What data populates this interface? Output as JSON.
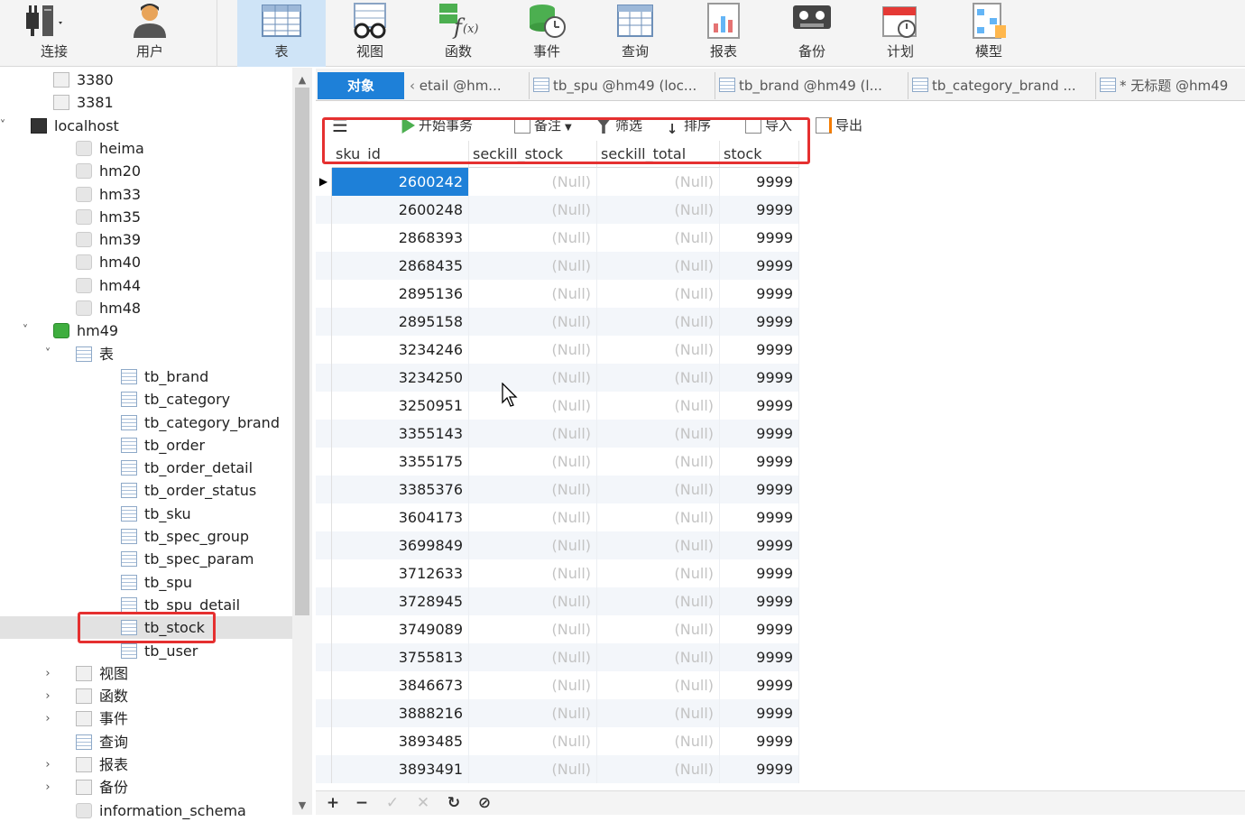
{
  "toolbar": {
    "connect": "连接",
    "user": "用户",
    "table": "表",
    "view": "视图",
    "function": "函数",
    "event": "事件",
    "query": "查询",
    "report": "报表",
    "backup": "备份",
    "schedule": "计划",
    "model": "模型"
  },
  "sidebar": {
    "items": [
      {
        "label": "3380"
      },
      {
        "label": "3381"
      },
      {
        "label": "localhost"
      },
      {
        "label": "heima"
      },
      {
        "label": "hm20"
      },
      {
        "label": "hm33"
      },
      {
        "label": "hm35"
      },
      {
        "label": "hm39"
      },
      {
        "label": "hm40"
      },
      {
        "label": "hm44"
      },
      {
        "label": "hm48"
      },
      {
        "label": "hm49"
      },
      {
        "label": "表"
      },
      {
        "label": "tb_brand"
      },
      {
        "label": "tb_category"
      },
      {
        "label": "tb_category_brand"
      },
      {
        "label": "tb_order"
      },
      {
        "label": "tb_order_detail"
      },
      {
        "label": "tb_order_status"
      },
      {
        "label": "tb_sku"
      },
      {
        "label": "tb_spec_group"
      },
      {
        "label": "tb_spec_param"
      },
      {
        "label": "tb_spu"
      },
      {
        "label": "tb_spu_detail"
      },
      {
        "label": "tb_stock"
      },
      {
        "label": "tb_user"
      },
      {
        "label": "视图"
      },
      {
        "label": "函数"
      },
      {
        "label": "事件"
      },
      {
        "label": "查询"
      },
      {
        "label": "报表"
      },
      {
        "label": "备份"
      },
      {
        "label": "information_schema"
      }
    ]
  },
  "tabs": {
    "objects": "对象",
    "items": [
      "etail @hm...",
      "tb_spu @hm49 (loc...",
      "tb_brand @hm49 (l...",
      "tb_category_brand ...",
      "* 无标题 @hm49"
    ]
  },
  "objbar": {
    "begin_transaction": "开始事务",
    "memo": "备注",
    "filter": "筛选",
    "sort": "排序",
    "import": "导入",
    "export": "导出"
  },
  "grid": {
    "columns": [
      "sku_id",
      "seckill_stock",
      "seckill_total",
      "stock"
    ],
    "null_text": "(Null)",
    "rows": [
      [
        "2600242",
        "(Null)",
        "(Null)",
        "9999"
      ],
      [
        "2600248",
        "(Null)",
        "(Null)",
        "9999"
      ],
      [
        "2868393",
        "(Null)",
        "(Null)",
        "9999"
      ],
      [
        "2868435",
        "(Null)",
        "(Null)",
        "9999"
      ],
      [
        "2895136",
        "(Null)",
        "(Null)",
        "9999"
      ],
      [
        "2895158",
        "(Null)",
        "(Null)",
        "9999"
      ],
      [
        "3234246",
        "(Null)",
        "(Null)",
        "9999"
      ],
      [
        "3234250",
        "(Null)",
        "(Null)",
        "9999"
      ],
      [
        "3250951",
        "(Null)",
        "(Null)",
        "9999"
      ],
      [
        "3355143",
        "(Null)",
        "(Null)",
        "9999"
      ],
      [
        "3355175",
        "(Null)",
        "(Null)",
        "9999"
      ],
      [
        "3385376",
        "(Null)",
        "(Null)",
        "9999"
      ],
      [
        "3604173",
        "(Null)",
        "(Null)",
        "9999"
      ],
      [
        "3699849",
        "(Null)",
        "(Null)",
        "9999"
      ],
      [
        "3712633",
        "(Null)",
        "(Null)",
        "9999"
      ],
      [
        "3728945",
        "(Null)",
        "(Null)",
        "9999"
      ],
      [
        "3749089",
        "(Null)",
        "(Null)",
        "9999"
      ],
      [
        "3755813",
        "(Null)",
        "(Null)",
        "9999"
      ],
      [
        "3846673",
        "(Null)",
        "(Null)",
        "9999"
      ],
      [
        "3888216",
        "(Null)",
        "(Null)",
        "9999"
      ],
      [
        "3893485",
        "(Null)",
        "(Null)",
        "9999"
      ],
      [
        "3893491",
        "(Null)",
        "(Null)",
        "9999"
      ]
    ]
  },
  "colors": {
    "accent": "#1e80d8",
    "highlight_box": "#e53030",
    "null_text": "#c4c4c4"
  }
}
